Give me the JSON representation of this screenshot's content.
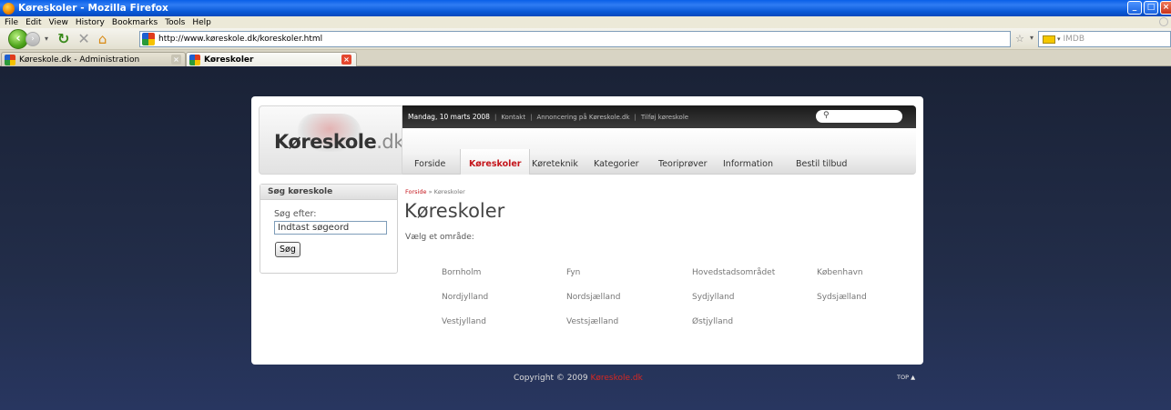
{
  "browser": {
    "window_title": "Køreskoler - Mozilla Firefox",
    "menu": [
      "File",
      "Edit",
      "View",
      "History",
      "Bookmarks",
      "Tools",
      "Help"
    ],
    "url": "http://www.køreskole.dk/koreskoler.html",
    "search_placeholder": "IMDB",
    "tabs": [
      {
        "label": "Køreskole.dk - Administration",
        "active": false
      },
      {
        "label": "Køreskoler",
        "active": true
      }
    ]
  },
  "site": {
    "logo_main": "Køreskole",
    "logo_suffix": ".dk",
    "topbar": {
      "date": "Mandag, 10 marts 2008",
      "links": [
        "Kontakt",
        "Annoncering på Køreskole.dk",
        "Tilføj køreskole"
      ]
    },
    "nav": [
      "Forside",
      "Køreskoler",
      "Køreteknik",
      "Kategorier",
      "Teoriprøver",
      "Information",
      "Bestil tilbud"
    ],
    "active_nav": "Køreskoler",
    "search_box": {
      "title": "Søg køreskole",
      "label": "Søg efter:",
      "input_value": "Indtast søgeord",
      "button": "Søg"
    },
    "breadcrumb": {
      "home": "Forside",
      "separator": "»",
      "current": "Køreskoler"
    },
    "page_title": "Køreskoler",
    "intro": "Vælg et område:",
    "regions": [
      "Bornholm",
      "Fyn",
      "Hovedstadsområdet",
      "København",
      "Nordjylland",
      "Nordsjælland",
      "Sydjylland",
      "Sydsjælland",
      "Vestjylland",
      "Vestsjælland",
      "Østjylland"
    ],
    "footer": {
      "copyright_prefix": "Copyright © 2009",
      "copyright_brand": "Køreskole.dk",
      "top_link": "TOP ▲"
    }
  },
  "colors": {
    "accent": "#c4161c",
    "page_background": "#1c2640"
  }
}
